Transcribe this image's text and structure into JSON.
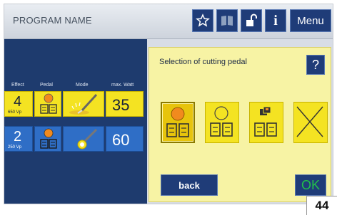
{
  "header": {
    "program_name": "PROGRAM NAME",
    "menu_label": "Menu",
    "info_label": "i"
  },
  "table": {
    "headers": [
      "Effect",
      "Pedal",
      "Mode",
      "max. Watt"
    ],
    "rows": [
      {
        "effect": "4",
        "effect_sub": "650 Vp",
        "watt": "35",
        "color": "yellow"
      },
      {
        "effect": "2",
        "effect_sub": "250 Vp",
        "watt": "60",
        "color": "blue"
      }
    ]
  },
  "dialog": {
    "title": "Selection of cutting pedal",
    "help_label": "?",
    "back_label": "back",
    "ok_label": "OK",
    "options": [
      "pedal-cut-selected",
      "pedal-cut-empty",
      "pedal-copy",
      "no-pedal"
    ]
  },
  "page_number": "44",
  "colors": {
    "navy": "#1f3c78",
    "panel_blue": "#1e3b6e",
    "yellow": "#f4e322",
    "dialog_bg": "#f7f3a4",
    "orange": "#f18a1e",
    "ok_green": "#22c04a"
  }
}
